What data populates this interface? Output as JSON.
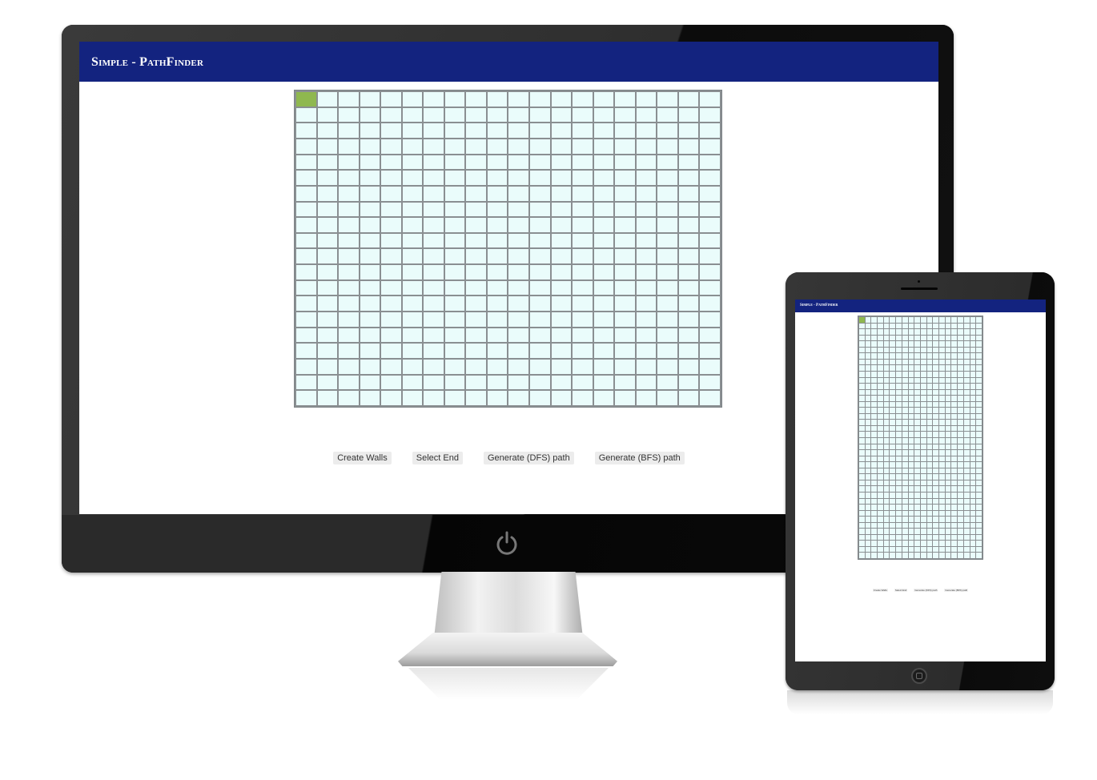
{
  "desktop": {
    "app": {
      "title": "Simple - PathFinder",
      "grid": {
        "rows": 20,
        "cols": 20,
        "start_cell": [
          0,
          0
        ]
      },
      "buttons": {
        "create_walls": "Create Walls",
        "select_end": "Select End",
        "generate_dfs": "Generate (DFS) path",
        "generate_bfs": "Generate (BFS) path"
      }
    },
    "icons": {
      "power": "power-icon"
    }
  },
  "tablet": {
    "app": {
      "title": "Simple - PathFinder",
      "grid": {
        "rows": 40,
        "cols": 20,
        "start_cell": [
          0,
          0
        ]
      },
      "buttons": {
        "create_walls": "Create Walls",
        "select_end": "Select End",
        "generate_dfs": "Generate (DFS) path",
        "generate_bfs": "Generate (BFS) path"
      }
    },
    "icons": {
      "home": "home-button-icon"
    }
  },
  "colors": {
    "header": "#13237f",
    "cell": "#eafcfb",
    "cell_border": "#8a8f92",
    "start_cell": "#8fb84f",
    "button_bg": "#ececec"
  }
}
